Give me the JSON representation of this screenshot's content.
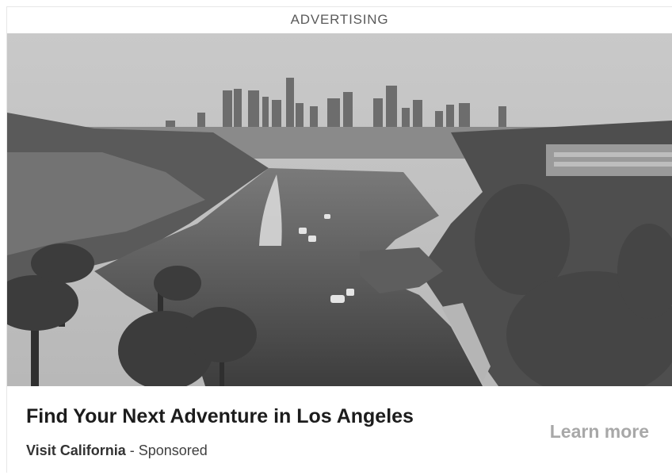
{
  "ad": {
    "label": "ADVERTISING",
    "image": {
      "description_icon": "city-skyline-lake-photo-icon"
    },
    "headline": "Find Your Next Adventure in Los Angeles",
    "advertiser": "Visit California",
    "separator": " - ",
    "sponsored": "Sponsored",
    "cta": "Learn more"
  },
  "colors": {
    "header_text": "#5a5a5a",
    "headline_text": "#1c1c1c",
    "cta_text": "#a8a8a8"
  }
}
